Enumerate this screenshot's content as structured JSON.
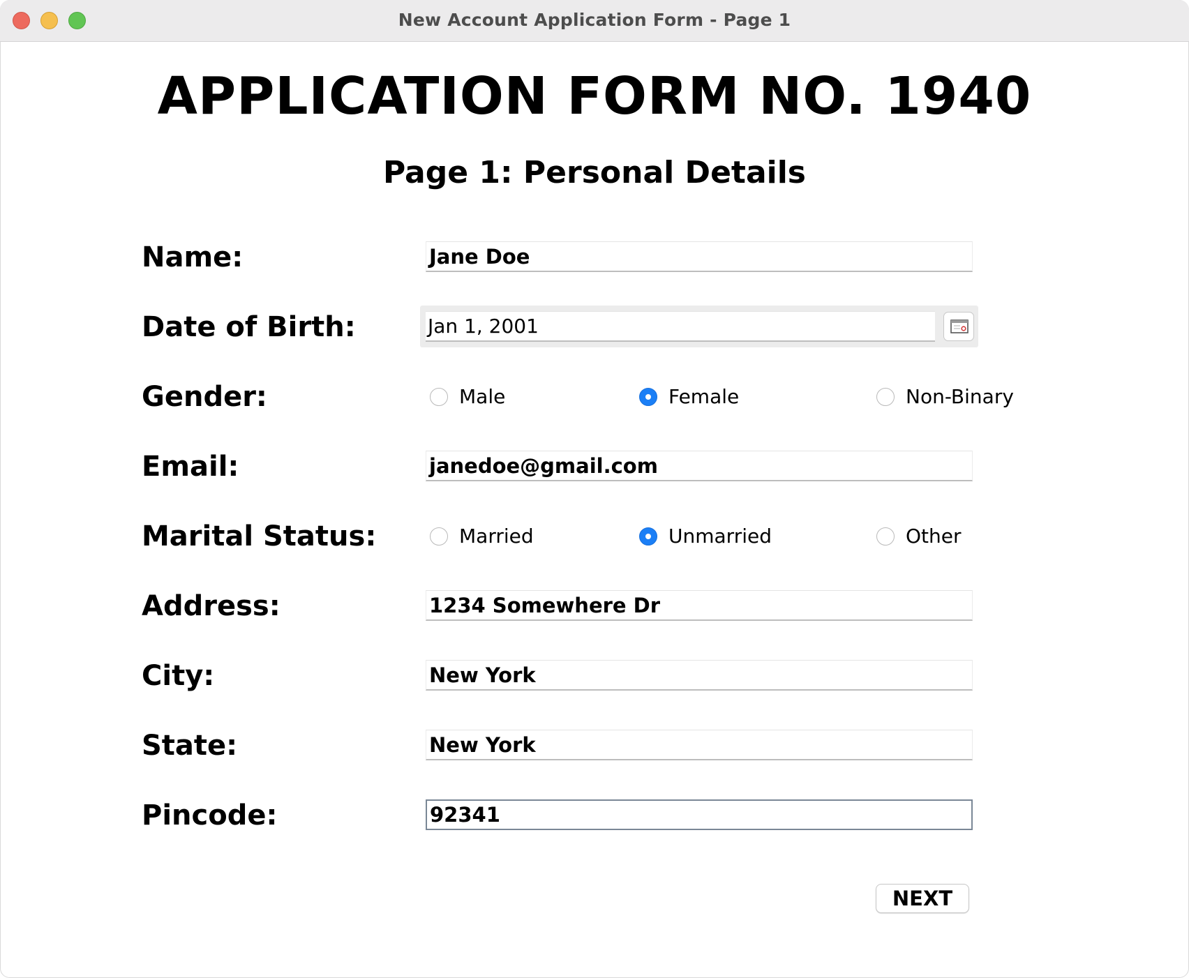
{
  "window": {
    "title": "New Account Application Form - Page 1"
  },
  "form": {
    "heading": "APPLICATION FORM NO. 1940",
    "subheading": "Page 1: Personal Details",
    "name": {
      "label": "Name:",
      "value": "Jane Doe"
    },
    "dob": {
      "label": "Date of Birth:",
      "value": "Jan 1, 2001"
    },
    "gender": {
      "label": "Gender:",
      "options": [
        "Male",
        "Female",
        "Non-Binary"
      ],
      "selected": "Female"
    },
    "email": {
      "label": "Email:",
      "value": "janedoe@gmail.com"
    },
    "marital": {
      "label": "Marital Status:",
      "options": [
        "Married",
        "Unmarried",
        "Other"
      ],
      "selected": "Unmarried"
    },
    "address": {
      "label": "Address:",
      "value": "1234 Somewhere Dr"
    },
    "city": {
      "label": "City:",
      "value": "New York"
    },
    "state": {
      "label": "State:",
      "value": "New York"
    },
    "pincode": {
      "label": "Pincode:",
      "value": "92341"
    },
    "next_label": "NEXT"
  },
  "icons": {
    "date_picker": "calendar-icon"
  },
  "colors": {
    "radio_selected": "#1b7ff6",
    "titlebar": "#ecebec",
    "close": "#ed6a5e",
    "minimize": "#f5bf4f",
    "maximize": "#61c554"
  }
}
